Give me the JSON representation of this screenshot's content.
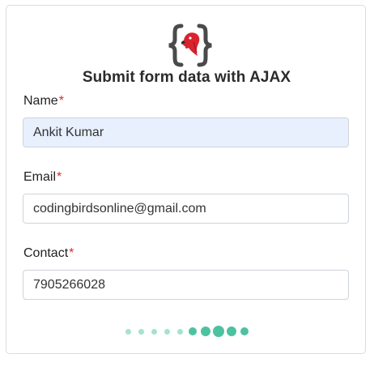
{
  "form": {
    "title": "Submit form data with AJAX",
    "logo_icon": "curly-braces-bird-logo",
    "required_marker": "*",
    "fields": {
      "name": {
        "label": "Name",
        "value": "Ankit Kumar"
      },
      "email": {
        "label": "Email",
        "value": "codingbirdsonline@gmail.com"
      },
      "contact": {
        "label": "Contact",
        "value": "7905266028"
      }
    }
  },
  "loader": {
    "icon": "loading-dots-indicator",
    "dot_count": 10,
    "active_dot": 7
  },
  "colors": {
    "required": "#e0262e",
    "autofill_bg": "#e8f0fe",
    "loader_active": "#4ec2a0",
    "loader_inactive": "#a6e2cf",
    "brace": "#4a4a4a",
    "bird": "#d9232e"
  }
}
